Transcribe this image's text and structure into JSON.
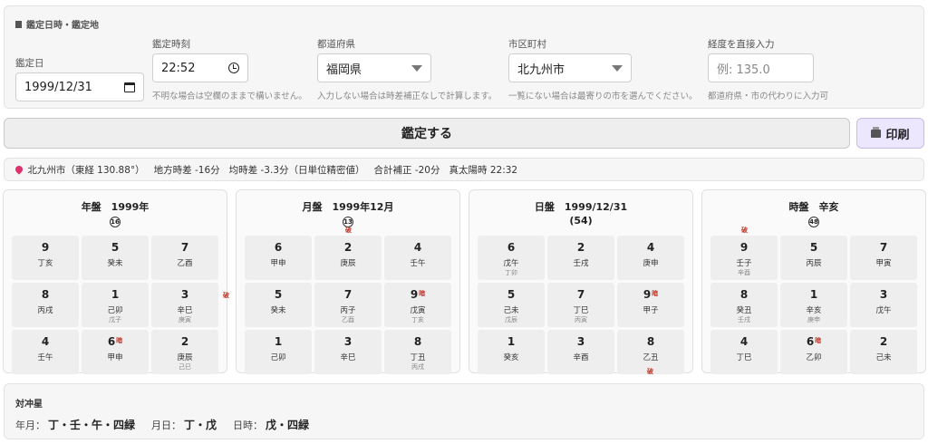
{
  "form": {
    "section_title": "鑑定日時・鑑定地",
    "date_label": "鑑定日",
    "date_value": "1999/12/31",
    "time_label": "鑑定時刻",
    "time_value": "22:52",
    "time_hint": "不明な場合は空欄のままで構いません。",
    "pref_label": "都道府県",
    "pref_value": "福岡県",
    "pref_hint": "入力しない場合は時差補正なしで計算します。",
    "city_label": "市区町村",
    "city_value": "北九州市",
    "city_hint": "一覧にない場合は最寄りの市を選んでください。",
    "lon_label": "経度を直接入力",
    "lon_placeholder": "例: 135.0",
    "lon_hint": "都道府県・市の代わりに入力可"
  },
  "buttons": {
    "calc": "鑑定する",
    "print": "印刷"
  },
  "info": {
    "location": "北九州市（東経 130.88°）",
    "local_diff": "地方時差 -16分",
    "equation": "均時差 -3.3分（日単位精密値）",
    "total": "合計補正 -20分",
    "solar_time": "真太陽時 22:32"
  },
  "boards": [
    {
      "title": "年盤　1999年",
      "sub": "",
      "circ": "16",
      "cells": [
        {
          "num": "9",
          "main": "丁亥",
          "sub": "",
          "mark": ""
        },
        {
          "num": "5",
          "main": "癸未",
          "sub": "",
          "mark": ""
        },
        {
          "num": "7",
          "main": "乙酉",
          "sub": "",
          "mark": ""
        },
        {
          "num": "8",
          "main": "丙戌",
          "sub": "",
          "mark": ""
        },
        {
          "num": "1",
          "main": "己卯",
          "sub": "戊子",
          "mark": ""
        },
        {
          "num": "3",
          "main": "辛巳",
          "sub": "庚寅",
          "mark": ""
        },
        {
          "num": "4",
          "main": "壬午",
          "sub": "",
          "mark": ""
        },
        {
          "num": "6",
          "main": "甲申",
          "sub": "",
          "mark": "暗"
        },
        {
          "num": "2",
          "main": "庚辰",
          "sub": "己巳",
          "mark": ""
        }
      ]
    },
    {
      "title": "月盤　1999年12月",
      "sub": "",
      "circ": "13",
      "cells": [
        {
          "num": "6",
          "main": "甲申",
          "sub": "",
          "mark": ""
        },
        {
          "num": "2",
          "main": "庚辰",
          "sub": "",
          "mark": ""
        },
        {
          "num": "4",
          "main": "壬午",
          "sub": "",
          "mark": ""
        },
        {
          "num": "5",
          "main": "癸未",
          "sub": "",
          "mark": ""
        },
        {
          "num": "7",
          "main": "丙子",
          "sub": "乙酉",
          "mark": ""
        },
        {
          "num": "9",
          "main": "戊寅",
          "sub": "丁亥",
          "mark": "暗"
        },
        {
          "num": "1",
          "main": "己卯",
          "sub": "",
          "mark": ""
        },
        {
          "num": "3",
          "main": "辛巳",
          "sub": "",
          "mark": ""
        },
        {
          "num": "8",
          "main": "丁丑",
          "sub": "丙戌",
          "mark": ""
        }
      ]
    },
    {
      "title": "日盤　1999/12/31",
      "sub": "(54)",
      "circ": "",
      "cells": [
        {
          "num": "6",
          "main": "戊午",
          "sub": "丁卯",
          "mark": ""
        },
        {
          "num": "2",
          "main": "壬戌",
          "sub": "",
          "mark": ""
        },
        {
          "num": "4",
          "main": "庚申",
          "sub": "",
          "mark": ""
        },
        {
          "num": "5",
          "main": "己未",
          "sub": "戊辰",
          "mark": ""
        },
        {
          "num": "7",
          "main": "丁巳",
          "sub": "丙寅",
          "mark": ""
        },
        {
          "num": "9",
          "main": "甲子",
          "sub": "",
          "mark": "暗"
        },
        {
          "num": "1",
          "main": "癸亥",
          "sub": "",
          "mark": ""
        },
        {
          "num": "3",
          "main": "辛酉",
          "sub": "",
          "mark": ""
        },
        {
          "num": "8",
          "main": "乙丑",
          "sub": "",
          "mark": ""
        }
      ]
    },
    {
      "title": "時盤　辛亥",
      "sub": "",
      "circ": "48",
      "cells": [
        {
          "num": "9",
          "main": "壬子",
          "sub": "辛酉",
          "mark": ""
        },
        {
          "num": "5",
          "main": "丙辰",
          "sub": "",
          "mark": ""
        },
        {
          "num": "7",
          "main": "甲寅",
          "sub": "",
          "mark": ""
        },
        {
          "num": "8",
          "main": "癸丑",
          "sub": "壬戌",
          "mark": ""
        },
        {
          "num": "1",
          "main": "辛亥",
          "sub": "庚申",
          "mark": ""
        },
        {
          "num": "3",
          "main": "戊午",
          "sub": "",
          "mark": ""
        },
        {
          "num": "4",
          "main": "丁巳",
          "sub": "",
          "mark": ""
        },
        {
          "num": "6",
          "main": "乙卯",
          "sub": "",
          "mark": "暗"
        },
        {
          "num": "2",
          "main": "己未",
          "sub": "",
          "mark": ""
        }
      ]
    }
  ],
  "ha_mark": "破",
  "taichu": {
    "title": "対冲星",
    "year_month_label": "年月：",
    "year_month_value": "丁・壬・午・四緑",
    "month_day_label": "月日：",
    "month_day_value": "丁・戊",
    "day_time_label": "日時：",
    "day_time_value": "戊・四緑"
  }
}
